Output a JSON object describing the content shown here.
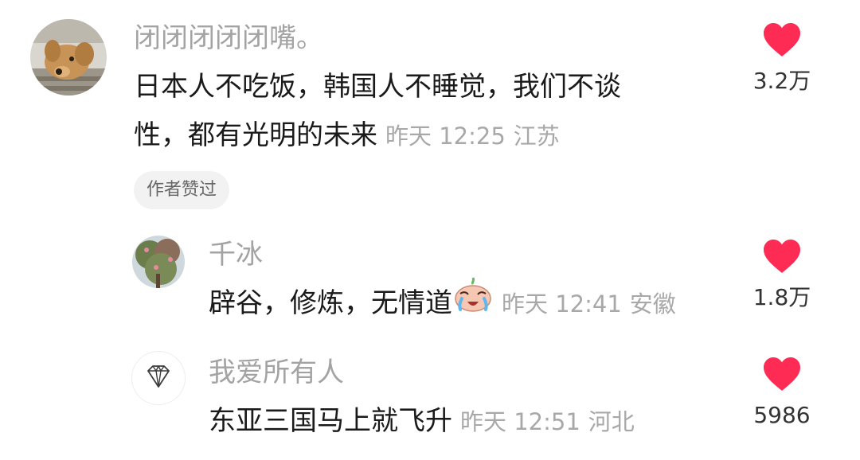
{
  "comments": [
    {
      "username": "闭闭闭闭闭嘴。",
      "text_line1": "日本人不吃饭，韩国人不睡觉，我们不谈",
      "text_line2": "性，都有光明的未来",
      "time": "昨天 12:25",
      "location": "江苏",
      "badge": "作者赞过",
      "likes": "3.2万"
    },
    {
      "username": "千冰",
      "text": "辟谷，修炼，无情道",
      "emoji": "crying-laughing-emoji",
      "time": "昨天 12:41",
      "location": "安徽",
      "likes": "1.8万"
    },
    {
      "username": "我爱所有人",
      "text": "东亚三国马上就飞升",
      "time": "昨天 12:51",
      "location": "河北",
      "likes": "5986"
    }
  ],
  "colors": {
    "heart": "#fe2c55",
    "username": "#a3a3a3",
    "text": "#1a1a1a",
    "badge_bg": "#f2f2f2"
  }
}
